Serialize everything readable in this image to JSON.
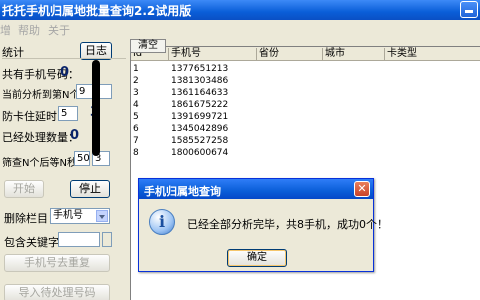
{
  "window": {
    "title": "托托手机归属地批量查询2.2试用版"
  },
  "menu": {
    "items": [
      "增",
      "帮助",
      "关于"
    ]
  },
  "left": {
    "stats_label": "统计",
    "log_button": "日志",
    "total_label": "共有手机号码：",
    "total_value": "0",
    "current_label": "当前分析到第N个：",
    "current_value": "9",
    "timeout_label": "防卡住延时：",
    "timeout_value": "5",
    "timeout_extra": "3",
    "processed_label": "已经处理数量：",
    "processed_value": "0",
    "wait_label": "筛查N个后等N秒",
    "wait_n": "50",
    "wait_s": "3",
    "start_button": "开始",
    "stop_button": "停止",
    "delete_col_label": "删除栏目：",
    "delete_col_value": "手机号",
    "keyword_label": "包含关键字：",
    "dedupe_button": "手机号去重复",
    "import_button": "导入待处理号码"
  },
  "grid": {
    "clear_button": "清空",
    "columns": [
      "id",
      "手机号",
      "省份",
      "城市",
      "卡类型"
    ],
    "rows": [
      {
        "id": "1",
        "phone": "1377651213"
      },
      {
        "id": "2",
        "phone": "1381303486"
      },
      {
        "id": "3",
        "phone": "1361164633"
      },
      {
        "id": "4",
        "phone": "1861675222"
      },
      {
        "id": "5",
        "phone": "1391699721"
      },
      {
        "id": "6",
        "phone": "1345042896"
      },
      {
        "id": "7",
        "phone": "1585527258"
      },
      {
        "id": "8",
        "phone": "1800600674"
      }
    ]
  },
  "dialog": {
    "title": "手机归属地查询",
    "message": "已经全部分析完毕，共8手机，成功0个！",
    "ok_button": "确定"
  }
}
